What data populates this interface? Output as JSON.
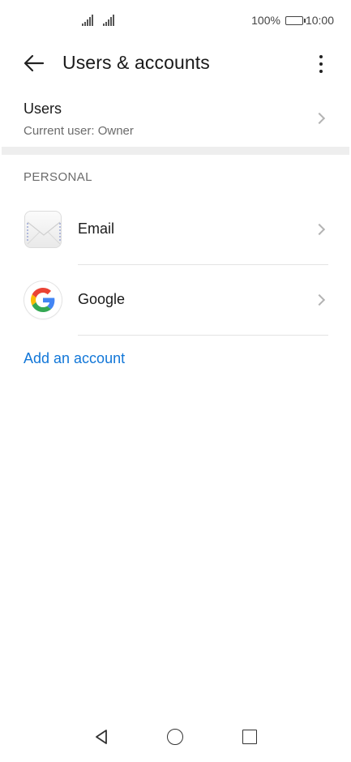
{
  "status_bar": {
    "battery_text": "100%",
    "time": "10:00"
  },
  "header": {
    "title": "Users & accounts"
  },
  "users": {
    "title": "Users",
    "subtitle": "Current user: Owner"
  },
  "section": {
    "label": "PERSONAL"
  },
  "accounts": [
    {
      "label": "Email",
      "icon": "email-envelope-icon"
    },
    {
      "label": "Google",
      "icon": "google-logo-icon"
    }
  ],
  "add_account_label": "Add an account",
  "colors": {
    "accent": "#1277d8",
    "google_blue": "#4285F4",
    "google_red": "#EA4335",
    "google_yellow": "#FBBC05",
    "google_green": "#34A853"
  }
}
